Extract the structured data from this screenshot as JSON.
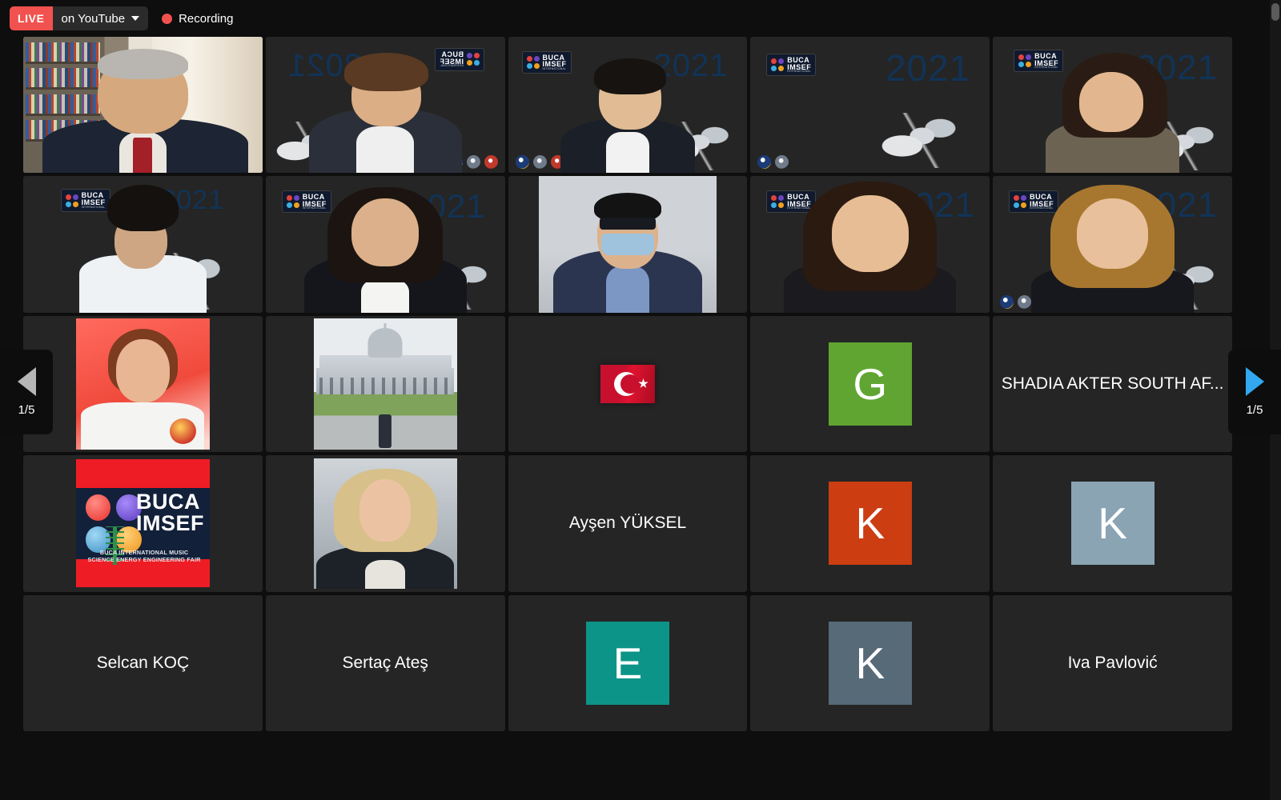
{
  "topbar": {
    "live_badge": "LIVE",
    "destination": "on YouTube",
    "dropdown_icon": "chevron-down-icon",
    "recording_dot_icon": "record-dot-icon",
    "recording_label": "Recording",
    "live_color": "#f2524f",
    "recording_color": "#f2524f"
  },
  "nav": {
    "prev_icon": "triangle-left-icon",
    "prev_page": "1/5",
    "next_icon": "triangle-right-icon",
    "next_page": "1/5",
    "prev_color": "#b6b6b6",
    "next_color": "#31a8f0"
  },
  "grid": {
    "columns": 5,
    "rows": 5,
    "active_speaker_border_color": "#a9d84c",
    "tile_background": "#252525",
    "tiles": [
      {
        "id": "t1",
        "kind": "video",
        "name": "",
        "active": true,
        "scene": "bookshelf-room"
      },
      {
        "id": "t2",
        "kind": "video",
        "name": "",
        "active": false,
        "scene": "buca-2021-mirrored",
        "year": "2021",
        "logo_text": "BUCA IMSEF"
      },
      {
        "id": "t3",
        "kind": "video",
        "name": "",
        "active": false,
        "scene": "buca-2021",
        "year": "2021",
        "logo_text": "BUCA IMSEF"
      },
      {
        "id": "t4",
        "kind": "video",
        "name": "",
        "active": false,
        "scene": "buca-2021",
        "year": "2021",
        "logo_text": "BUCA IMSEF"
      },
      {
        "id": "t5",
        "kind": "video",
        "name": "",
        "active": false,
        "scene": "buca-2021",
        "year": "2021",
        "logo_text": "BUCA IMSEF"
      },
      {
        "id": "t6",
        "kind": "video",
        "name": "",
        "active": false,
        "scene": "buca-2021-letterbox",
        "year": "2021",
        "logo_text": "BUCA IMSEF"
      },
      {
        "id": "t7",
        "kind": "video",
        "name": "",
        "active": false,
        "scene": "buca-2021",
        "year": "2021",
        "logo_text": "BUCA IMSEF"
      },
      {
        "id": "t8",
        "kind": "video",
        "name": "",
        "active": false,
        "scene": "masked-person-letterbox"
      },
      {
        "id": "t9",
        "kind": "video",
        "name": "",
        "active": false,
        "scene": "buca-2021",
        "year": "2021",
        "logo_text": "BUCA IMSEF"
      },
      {
        "id": "t10",
        "kind": "video",
        "name": "",
        "active": false,
        "scene": "buca-2021",
        "year": "2021",
        "logo_text": "BUCA IMSEF"
      },
      {
        "id": "t11",
        "kind": "photo",
        "name": "",
        "active": false,
        "scene": "woman-red-backdrop"
      },
      {
        "id": "t12",
        "kind": "photo",
        "name": "",
        "active": false,
        "scene": "palace-building"
      },
      {
        "id": "t13",
        "kind": "photo",
        "name": "",
        "active": false,
        "scene": "turkish-flag"
      },
      {
        "id": "t14",
        "kind": "initial",
        "name": "",
        "active": false,
        "initial": "G",
        "color": "#60a532"
      },
      {
        "id": "t15",
        "kind": "name",
        "name": "SHADIA AKTER SOUTH AF...",
        "active": false
      },
      {
        "id": "t16",
        "kind": "photo",
        "name": "",
        "active": false,
        "scene": "buca-poster",
        "poster_title_line1": "BUCA",
        "poster_title_line2": "IMSEF",
        "poster_subtitle_line1": "BUCA INTERNATIONAL MUSIC",
        "poster_subtitle_line2": "SCIENCE ENERGY ENGINEERING FAIR"
      },
      {
        "id": "t17",
        "kind": "photo",
        "name": "",
        "active": false,
        "scene": "blonde-woman-portrait"
      },
      {
        "id": "t18",
        "kind": "name",
        "name": "Ayşen YÜKSEL",
        "active": false
      },
      {
        "id": "t19",
        "kind": "initial",
        "name": "",
        "active": false,
        "initial": "K",
        "color": "#cc3d12"
      },
      {
        "id": "t20",
        "kind": "initial",
        "name": "",
        "active": false,
        "initial": "K",
        "color": "#8aa4b4"
      },
      {
        "id": "t21",
        "kind": "name",
        "name": "Selcan KOÇ",
        "active": false
      },
      {
        "id": "t22",
        "kind": "name",
        "name": "Sertaç Ateş",
        "active": false
      },
      {
        "id": "t23",
        "kind": "initial",
        "name": "",
        "active": false,
        "initial": "E",
        "color": "#0d9488"
      },
      {
        "id": "t24",
        "kind": "initial",
        "name": "",
        "active": false,
        "initial": "K",
        "color": "#566a78"
      },
      {
        "id": "t25",
        "kind": "name",
        "name": "Iva Pavlović",
        "active": false
      }
    ]
  },
  "scrollbar": {
    "name": "vertical-scrollbar"
  }
}
